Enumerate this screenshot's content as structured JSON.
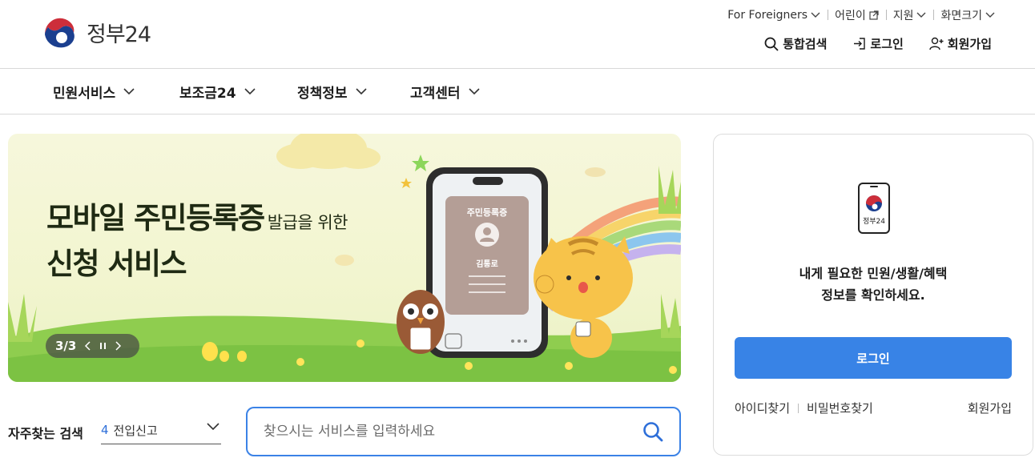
{
  "header": {
    "logo_text": "정부24",
    "util": {
      "foreigners": "For Foreigners",
      "kids": "어린이",
      "language": "지원",
      "font_size": "화면크기"
    },
    "actions": {
      "search": "통합검색",
      "login": "로그인",
      "signup": "회원가입"
    }
  },
  "nav": {
    "items": [
      {
        "label": "민원서비스"
      },
      {
        "label": "보조금24"
      },
      {
        "label": "정책정보"
      },
      {
        "label": "고객센터"
      }
    ]
  },
  "banner": {
    "title_main": "모바일 주민등록증",
    "title_sub": "발급을 위한",
    "title_line2": "신청 서비스",
    "card_title": "주민등록증",
    "card_name": "김통로",
    "pager_text": "3/3"
  },
  "search": {
    "label": "자주찾는 검색",
    "selected_num": "4",
    "selected_text": "전입신고",
    "placeholder": "찾으시는 서비스를 입력하세요"
  },
  "login_panel": {
    "app_label": "정부24",
    "message_line1": "내게 필요한 민원/생활/혜택",
    "message_line2": "정보를 확인하세요.",
    "login_button": "로그인",
    "find_id": "아이디찾기",
    "find_pw": "비밀번호찾기",
    "signup": "회원가입"
  },
  "colors": {
    "accent": "#3883e6",
    "search_border": "#3b82e6",
    "banner_bg": "#f4f6d6"
  }
}
